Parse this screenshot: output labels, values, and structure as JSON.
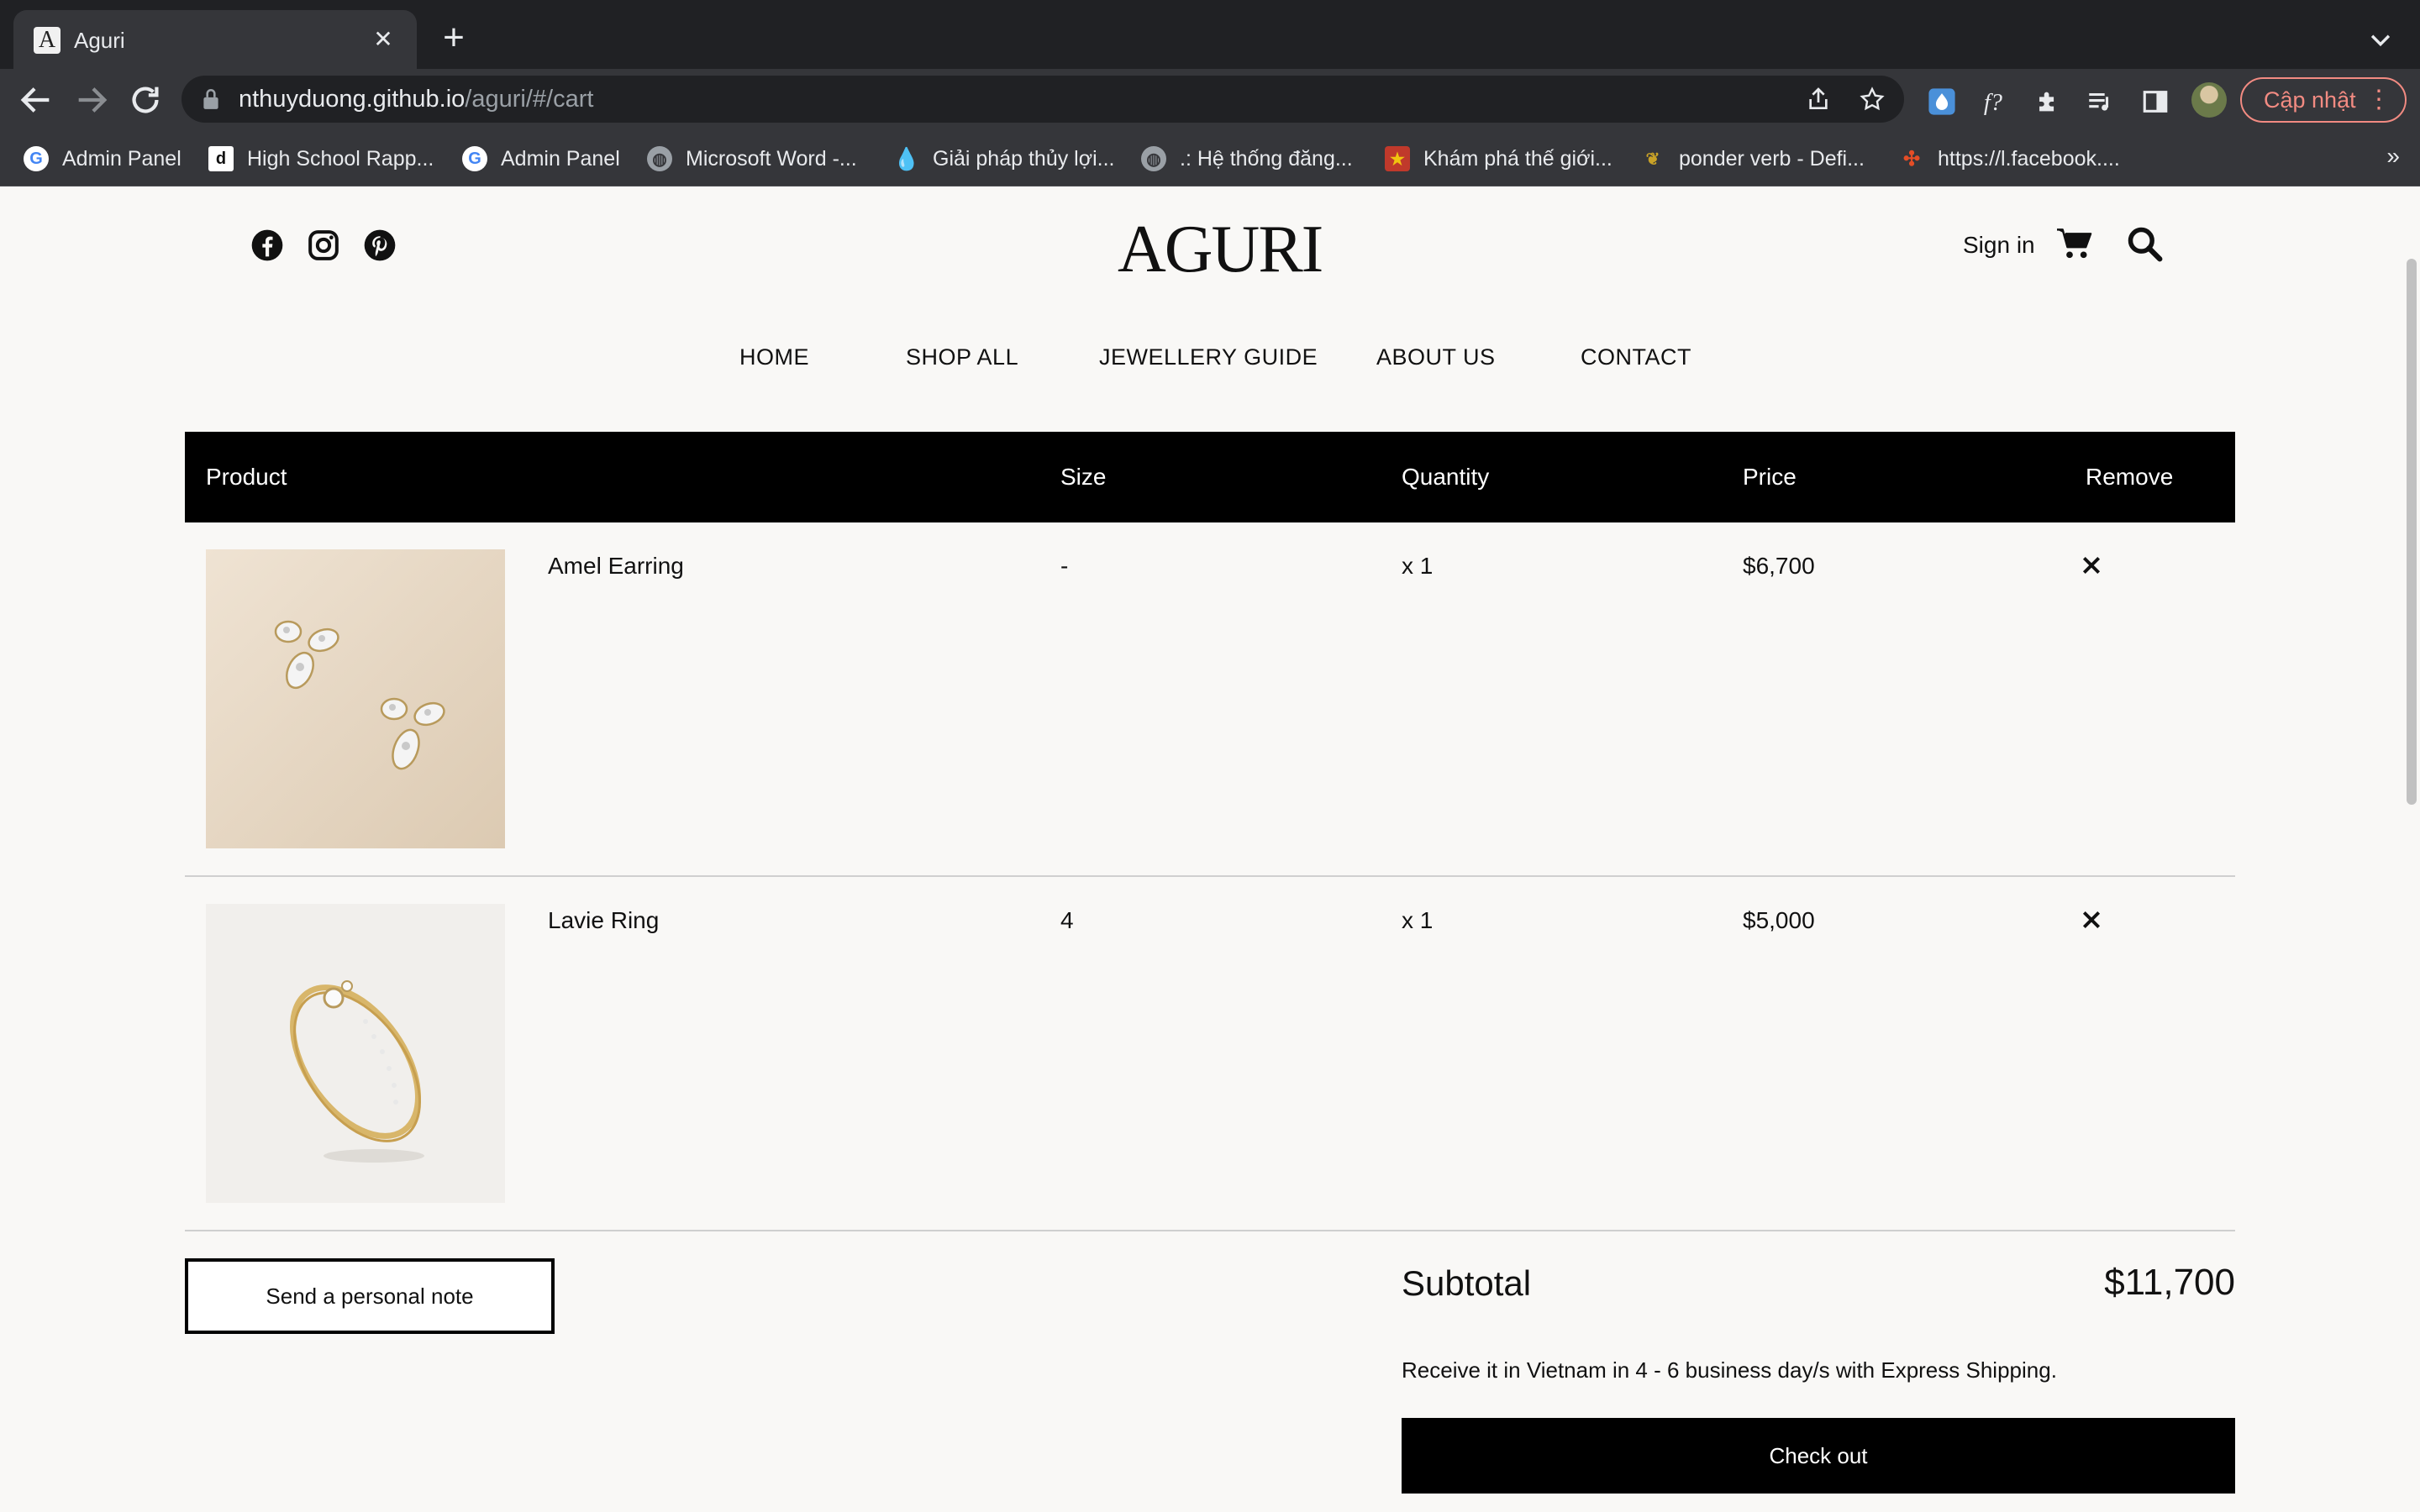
{
  "browser": {
    "tab_title": "Aguri",
    "tab_favicon_letter": "A",
    "tab_close": "✕",
    "new_tab": "+",
    "url_host": "nthuyduong.github.io",
    "url_path": "/aguri/#/cart",
    "update_label": "Cập nhật",
    "menu_dots": "⋮",
    "bookmarks": [
      {
        "label": "Admin Panel",
        "icon": "google-icon"
      },
      {
        "label": "High School Rapp...",
        "icon": "d-icon"
      },
      {
        "label": "Admin Panel",
        "icon": "google-icon"
      },
      {
        "label": "Microsoft Word -...",
        "icon": "globe-icon"
      },
      {
        "label": "Giải pháp thủy lợi...",
        "icon": "water-drop-icon"
      },
      {
        "label": ".: Hệ thống đăng...",
        "icon": "globe-icon"
      },
      {
        "label": "Khám phá thế giới...",
        "icon": "red-badge-icon"
      },
      {
        "label": "ponder verb - Defi...",
        "icon": "bird-icon"
      },
      {
        "label": "https://l.facebook....",
        "icon": "joomla-icon"
      }
    ],
    "bookmarks_overflow": "»"
  },
  "site": {
    "logo": "AGURI",
    "sign_in": "Sign in",
    "nav": [
      "HOME",
      "SHOP ALL",
      "JEWELLERY GUIDE",
      "ABOUT US",
      "CONTACT"
    ],
    "social_icons": [
      "facebook-icon",
      "instagram-icon",
      "pinterest-icon"
    ]
  },
  "cart": {
    "headers": {
      "product": "Product",
      "size": "Size",
      "quantity": "Quantity",
      "price": "Price",
      "remove": "Remove"
    },
    "items": [
      {
        "name": "Amel Earring",
        "size": "-",
        "quantity": "x 1",
        "price": "$6,700"
      },
      {
        "name": "Lavie Ring",
        "size": "4",
        "quantity": "x 1",
        "price": "$5,000"
      }
    ],
    "note_button": "Send a personal note",
    "subtotal_label": "Subtotal",
    "subtotal_value": "$11,700",
    "shipping_note": "Receive it in Vietnam in 4 - 6 business day/s with Express Shipping.",
    "checkout": "Check out"
  },
  "colors": {
    "chrome_dark": "#202124",
    "chrome_toolbar": "#35363a",
    "page_bg": "#f9f8f6",
    "accent_black": "#000000",
    "update_red": "#f28b82"
  }
}
